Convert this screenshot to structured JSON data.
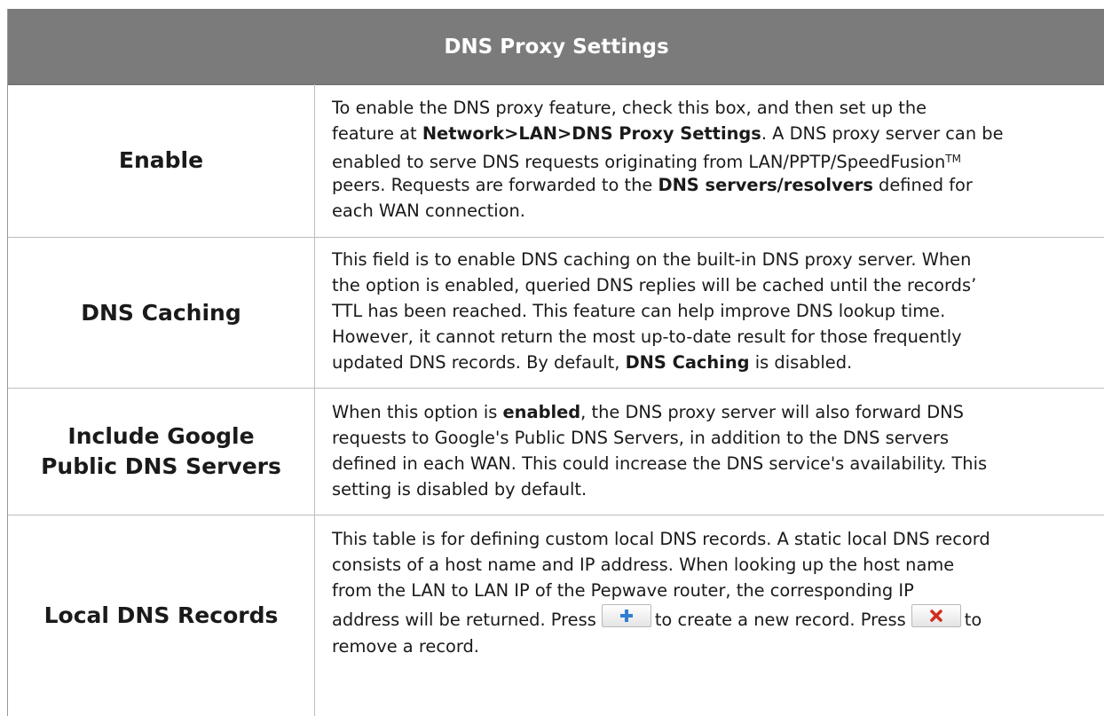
{
  "title": "DNS Proxy Settings",
  "rows": [
    {
      "label": "Enable",
      "lines": [
        "To enable the DNS proxy feature, check this box, and then set up the",
        [
          "feature at ",
          "Network>LAN>DNS Proxy Settings",
          ". A DNS proxy server can be"
        ],
        [
          "enabled to serve DNS requests originating from LAN/PPTP/SpeedFusion",
          "TM",
          ""
        ],
        [
          "peers. Requests are forwarded to the ",
          "DNS servers/resolvers",
          " defined for"
        ],
        "each WAN connection."
      ]
    },
    {
      "label": "DNS Caching",
      "lines": [
        "This field is to enable DNS caching on the built-in DNS proxy server. When",
        "the option is enabled, queried DNS replies will be cached until the records’",
        "TTL has been reached. This feature can help improve DNS lookup time.",
        "However, it cannot return the most up-to-date result for those frequently",
        [
          "updated DNS records. By default, ",
          "DNS Caching",
          " is disabled."
        ]
      ]
    },
    {
      "label_line1": "Include Google",
      "label_line2": "Public DNS Servers",
      "lines": [
        [
          "When this option is ",
          "enabled",
          ", the DNS proxy server will also forward DNS"
        ],
        "requests to Google's Public DNS Servers, in addition to the DNS servers",
        "defined in each WAN. This could increase the DNS service's availability. This",
        "setting is disabled by default."
      ]
    },
    {
      "label": "Local DNS Records",
      "lines": [
        "This table is for defining custom local DNS records. A static local DNS record",
        "consists of a host name and IP address. When looking up the host name",
        "from the LAN to LAN IP of the Pepwave router, the corresponding IP",
        [
          "address will be returned. Press",
          "to create a new record. Press",
          "to"
        ],
        "remove a record."
      ]
    }
  ],
  "icons": {
    "add": "plus-icon",
    "remove": "x-icon",
    "add_color": "#2f7fd1",
    "remove_color": "#d22b1a"
  }
}
